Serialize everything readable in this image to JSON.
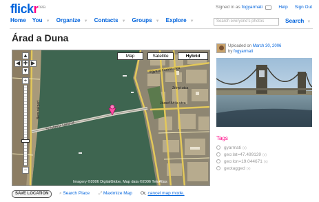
{
  "header": {
    "logo_main": "flick",
    "logo_accent": "r",
    "logo_badge": "beta",
    "signed_in_prefix": "Signed in as",
    "username": "fogyarmati",
    "links": [
      "Help",
      "Sign Out"
    ],
    "nav": [
      "Home",
      "You",
      "Organize",
      "Contacts",
      "Groups",
      "Explore"
    ],
    "search_placeholder": "Search everyone's photos",
    "search_label": "Search"
  },
  "page": {
    "title": "Árad a Duna"
  },
  "map": {
    "types": [
      "Map",
      "Satellite",
      "Hybrid"
    ],
    "active_type": "Hybrid",
    "copyright": "Imagery ©2006 DigitalGlobe, Map data ©2006 TeleAtlas",
    "streets": [
      "Széchenyi Lánchíd",
      "Bem rakpart",
      "Vigyázó Ferenc utca",
      "Zrínyi utca",
      "József Attila utca"
    ]
  },
  "sidebar": {
    "uploaded_prefix": "Uploaded on",
    "uploaded_date": "March 30, 2006",
    "by_prefix": "by",
    "uploader": "fogyarmati",
    "tags_title": "Tags",
    "tags": [
      "gyarmati",
      "geo:lat=47.499139",
      "geo:lon=19.044671",
      "geotagged"
    ]
  },
  "actions": {
    "save_location": "SAVE LOCATION",
    "search_place": "Search Place",
    "maximize_map": "Maximize Map",
    "or_text": "Or,",
    "cancel_map_mode": "cancel map mode."
  },
  "colors": {
    "brand_blue": "#0063dc",
    "brand_pink": "#ff0084"
  }
}
